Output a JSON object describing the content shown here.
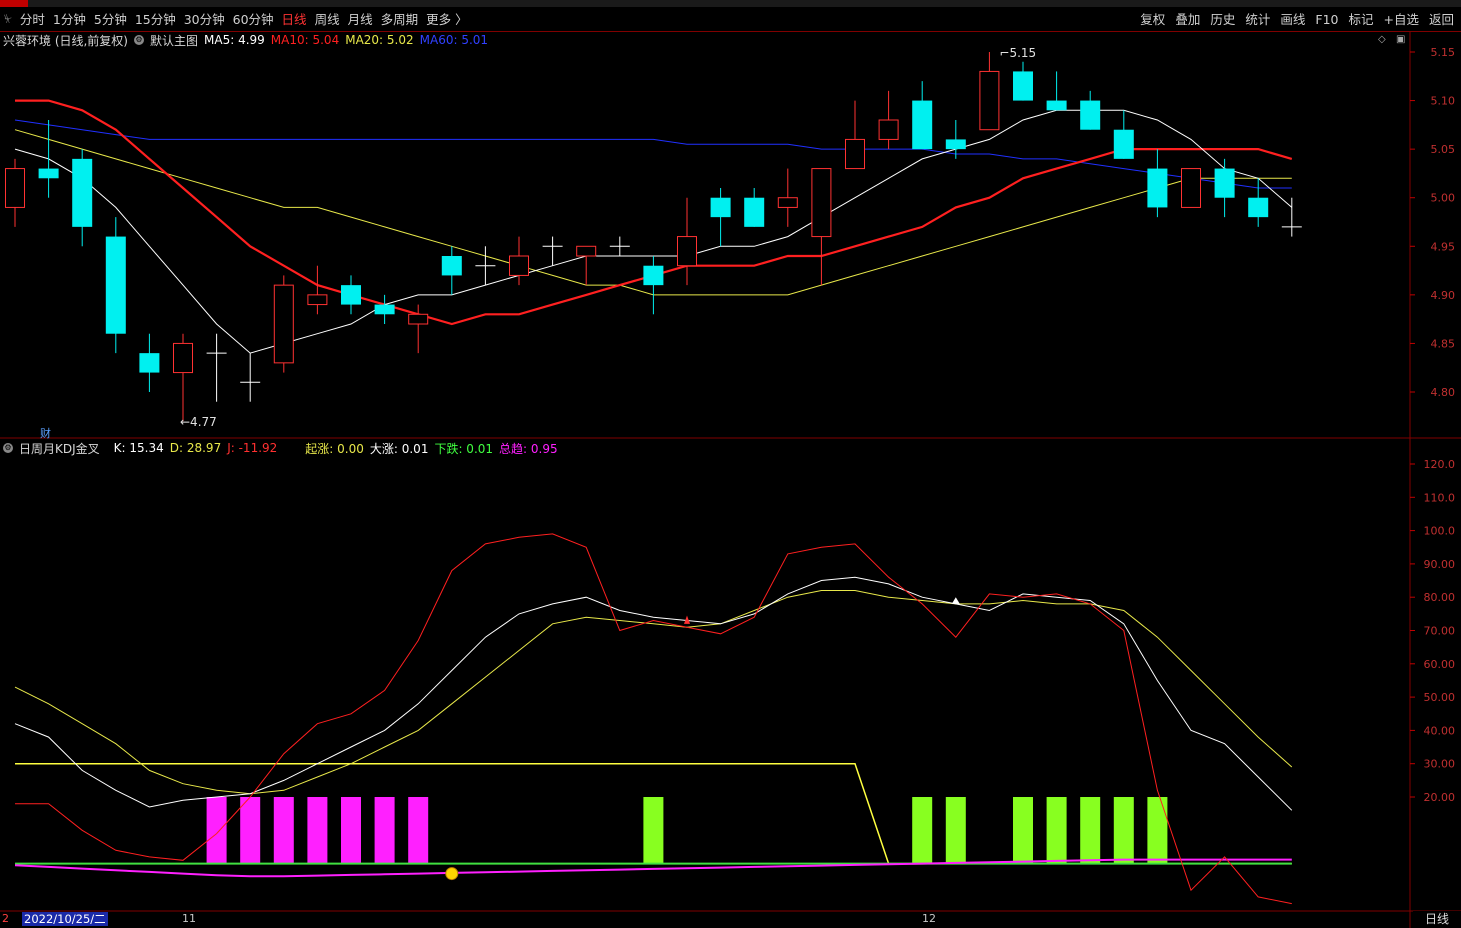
{
  "toolbar": {
    "left_items": [
      "分时",
      "1分钟",
      "5分钟",
      "15分钟",
      "30分钟",
      "60分钟",
      "日线",
      "周线",
      "月线",
      "多周期",
      "更多 〉"
    ],
    "active_index": 6,
    "right_items": [
      "复权",
      "叠加",
      "历史",
      "统计",
      "画线",
      "F10",
      "标记",
      "+自选",
      "返回"
    ]
  },
  "main_legend": {
    "stock": "兴蓉环境 (日线,前复权)",
    "template": "默认主图",
    "ma5": "MA5: 4.99",
    "ma10": "MA10: 5.04",
    "ma20": "MA20: 5.02",
    "ma60": "MA60: 5.01"
  },
  "sub_legend": {
    "name": "日周月KDJ金叉",
    "k": "K: 15.34",
    "d": "D: 28.97",
    "j": "J: -11.92",
    "qizhang": "起涨: 0.00",
    "dazhang": "大涨: 0.01",
    "xiadie": "下跌: 0.01",
    "zongqu": "总趋: 0.95"
  },
  "annotations": {
    "high": "5.15",
    "low": "4.77",
    "cai": "财"
  },
  "footer": {
    "date": "2022/10/25/二",
    "ticks": [
      "2",
      "11",
      "12"
    ],
    "period": "日线"
  },
  "colors": {
    "up": "#ff3232",
    "down": "#00f0f0",
    "ma5": "#ffffff",
    "ma10": "#ff2020",
    "ma20": "#e8e84a",
    "ma60": "#2030ff",
    "magenta": "#ff20ff",
    "lime": "#88ff20"
  },
  "chart_data": [
    {
      "type": "candlestick",
      "title": "兴蓉环境 (日线,前复权)",
      "ylim": [
        4.76,
        5.16
      ],
      "yticks": [
        "5.15",
        "5.10",
        "5.05",
        "5.00",
        "4.95",
        "4.90",
        "4.85",
        "4.80"
      ],
      "candles": [
        {
          "o": 4.99,
          "h": 5.04,
          "l": 4.97,
          "c": 5.03
        },
        {
          "o": 5.03,
          "h": 5.08,
          "l": 5.0,
          "c": 5.02
        },
        {
          "o": 5.04,
          "h": 5.05,
          "l": 4.95,
          "c": 4.97
        },
        {
          "o": 4.96,
          "h": 4.98,
          "l": 4.84,
          "c": 4.86
        },
        {
          "o": 4.84,
          "h": 4.86,
          "l": 4.8,
          "c": 4.82
        },
        {
          "o": 4.82,
          "h": 4.86,
          "l": 4.77,
          "c": 4.85
        },
        {
          "o": 4.84,
          "h": 4.86,
          "l": 4.79,
          "c": 4.84
        },
        {
          "o": 4.81,
          "h": 4.84,
          "l": 4.79,
          "c": 4.81
        },
        {
          "o": 4.83,
          "h": 4.92,
          "l": 4.82,
          "c": 4.91
        },
        {
          "o": 4.89,
          "h": 4.93,
          "l": 4.88,
          "c": 4.9
        },
        {
          "o": 4.91,
          "h": 4.92,
          "l": 4.88,
          "c": 4.89
        },
        {
          "o": 4.89,
          "h": 4.9,
          "l": 4.87,
          "c": 4.88
        },
        {
          "o": 4.87,
          "h": 4.89,
          "l": 4.84,
          "c": 4.88
        },
        {
          "o": 4.94,
          "h": 4.95,
          "l": 4.9,
          "c": 4.92
        },
        {
          "o": 4.93,
          "h": 4.95,
          "l": 4.91,
          "c": 4.93
        },
        {
          "o": 4.92,
          "h": 4.96,
          "l": 4.91,
          "c": 4.94
        },
        {
          "o": 4.95,
          "h": 4.96,
          "l": 4.93,
          "c": 4.95
        },
        {
          "o": 4.94,
          "h": 4.95,
          "l": 4.91,
          "c": 4.95
        },
        {
          "o": 4.95,
          "h": 4.96,
          "l": 4.94,
          "c": 4.95
        },
        {
          "o": 4.93,
          "h": 4.94,
          "l": 4.88,
          "c": 4.91
        },
        {
          "o": 4.93,
          "h": 5.0,
          "l": 4.91,
          "c": 4.96
        },
        {
          "o": 5.0,
          "h": 5.01,
          "l": 4.95,
          "c": 4.98
        },
        {
          "o": 5.0,
          "h": 5.01,
          "l": 4.97,
          "c": 4.97
        },
        {
          "o": 4.99,
          "h": 5.03,
          "l": 4.97,
          "c": 5.0
        },
        {
          "o": 4.96,
          "h": 5.03,
          "l": 4.91,
          "c": 5.03
        },
        {
          "o": 5.03,
          "h": 5.1,
          "l": 5.03,
          "c": 5.06
        },
        {
          "o": 5.06,
          "h": 5.11,
          "l": 5.05,
          "c": 5.08
        },
        {
          "o": 5.1,
          "h": 5.12,
          "l": 5.05,
          "c": 5.05
        },
        {
          "o": 5.06,
          "h": 5.08,
          "l": 5.04,
          "c": 5.05
        },
        {
          "o": 5.07,
          "h": 5.15,
          "l": 5.07,
          "c": 5.13
        },
        {
          "o": 5.13,
          "h": 5.14,
          "l": 5.1,
          "c": 5.1
        },
        {
          "o": 5.1,
          "h": 5.13,
          "l": 5.09,
          "c": 5.09
        },
        {
          "o": 5.1,
          "h": 5.11,
          "l": 5.07,
          "c": 5.07
        },
        {
          "o": 5.07,
          "h": 5.09,
          "l": 5.04,
          "c": 5.04
        },
        {
          "o": 5.03,
          "h": 5.05,
          "l": 4.98,
          "c": 4.99
        },
        {
          "o": 4.99,
          "h": 5.03,
          "l": 4.99,
          "c": 5.03
        },
        {
          "o": 5.03,
          "h": 5.04,
          "l": 4.98,
          "c": 5.0
        },
        {
          "o": 5.0,
          "h": 5.02,
          "l": 4.97,
          "c": 4.98
        },
        {
          "o": 4.97,
          "h": 5.0,
          "l": 4.96,
          "c": 4.97
        }
      ],
      "ma5": [
        5.05,
        5.04,
        5.02,
        4.99,
        4.95,
        4.91,
        4.87,
        4.84,
        4.85,
        4.86,
        4.87,
        4.89,
        4.9,
        4.9,
        4.91,
        4.92,
        4.93,
        4.94,
        4.94,
        4.94,
        4.94,
        4.95,
        4.95,
        4.96,
        4.98,
        5.0,
        5.02,
        5.04,
        5.05,
        5.06,
        5.08,
        5.09,
        5.09,
        5.09,
        5.08,
        5.06,
        5.03,
        5.02,
        4.99
      ],
      "ma10": [
        5.1,
        5.1,
        5.09,
        5.07,
        5.04,
        5.01,
        4.98,
        4.95,
        4.93,
        4.91,
        4.9,
        4.89,
        4.88,
        4.87,
        4.88,
        4.88,
        4.89,
        4.9,
        4.91,
        4.92,
        4.93,
        4.93,
        4.93,
        4.94,
        4.94,
        4.95,
        4.96,
        4.97,
        4.99,
        5.0,
        5.02,
        5.03,
        5.04,
        5.05,
        5.05,
        5.05,
        5.05,
        5.05,
        5.04
      ],
      "ma20": [
        5.07,
        5.06,
        5.05,
        5.04,
        5.03,
        5.02,
        5.01,
        5.0,
        4.99,
        4.99,
        4.98,
        4.97,
        4.96,
        4.95,
        4.94,
        4.93,
        4.92,
        4.91,
        4.91,
        4.9,
        4.9,
        4.9,
        4.9,
        4.9,
        4.91,
        4.92,
        4.93,
        4.94,
        4.95,
        4.96,
        4.97,
        4.98,
        4.99,
        5.0,
        5.01,
        5.02,
        5.02,
        5.02,
        5.02
      ],
      "ma60": [
        5.08,
        5.075,
        5.07,
        5.065,
        5.06,
        5.06,
        5.06,
        5.06,
        5.06,
        5.06,
        5.06,
        5.06,
        5.06,
        5.06,
        5.06,
        5.06,
        5.06,
        5.06,
        5.06,
        5.06,
        5.055,
        5.055,
        5.055,
        5.055,
        5.05,
        5.05,
        5.05,
        5.05,
        5.045,
        5.045,
        5.04,
        5.04,
        5.035,
        5.03,
        5.025,
        5.02,
        5.015,
        5.01,
        5.01
      ]
    },
    {
      "type": "line",
      "title": "日周月KDJ金叉",
      "ylim": [
        -20,
        125
      ],
      "yticks": [
        "120.0",
        "110.0",
        "100.0",
        "90.00",
        "80.00",
        "70.00",
        "60.00",
        "50.00",
        "40.00",
        "30.00",
        "20.00"
      ],
      "k": [
        42,
        38,
        28,
        22,
        17,
        19,
        20,
        21,
        25,
        30,
        35,
        40,
        48,
        58,
        68,
        75,
        78,
        80,
        76,
        74,
        73,
        72,
        75,
        81,
        85,
        86,
        84,
        80,
        78,
        76,
        81,
        80,
        79,
        72,
        55,
        40,
        36,
        26,
        16
      ],
      "d": [
        53,
        48,
        42,
        36,
        28,
        24,
        22,
        21,
        22,
        26,
        30,
        35,
        40,
        48,
        56,
        64,
        72,
        74,
        73,
        72,
        71,
        72,
        76,
        80,
        82,
        82,
        80,
        79,
        78,
        78,
        79,
        78,
        78,
        76,
        68,
        58,
        48,
        38,
        29
      ],
      "j": [
        18,
        18,
        10,
        4,
        2,
        1,
        9,
        20,
        33,
        42,
        45,
        52,
        67,
        88,
        96,
        98,
        99,
        95,
        70,
        73,
        71,
        69,
        74,
        93,
        95,
        96,
        86,
        78,
        68,
        81,
        80,
        81,
        78,
        70,
        22,
        -8,
        2,
        -10,
        -12
      ],
      "line_yellow": [
        30,
        30,
        30,
        30,
        30,
        30,
        30,
        30,
        30,
        30,
        30,
        30,
        30,
        30,
        30,
        30,
        30,
        30,
        30,
        30,
        30,
        30,
        30,
        30,
        30,
        30,
        0,
        0,
        0,
        0,
        0,
        0,
        0,
        0,
        0,
        0,
        0,
        0,
        0
      ],
      "line_magenta": [
        -0.5,
        -1,
        -1.5,
        -2,
        -2.5,
        -3,
        -3.5,
        -3.8,
        -3.8,
        -3.6,
        -3.4,
        -3.2,
        -3,
        -2.8,
        -2.6,
        -2.4,
        -2.2,
        -2,
        -1.8,
        -1.6,
        -1.4,
        -1.2,
        -1,
        -0.8,
        -0.6,
        -0.4,
        -0.2,
        0,
        0.2,
        0.4,
        0.6,
        0.8,
        1,
        1.2,
        1.2,
        1.2,
        1.2,
        1.2,
        1.2
      ],
      "line_green": 0,
      "magenta_bars": [
        6,
        7,
        8,
        9,
        10,
        11,
        12
      ],
      "lime_bars": [
        19,
        27,
        28,
        30,
        31,
        32,
        33,
        34
      ],
      "bar_height": 20
    }
  ]
}
